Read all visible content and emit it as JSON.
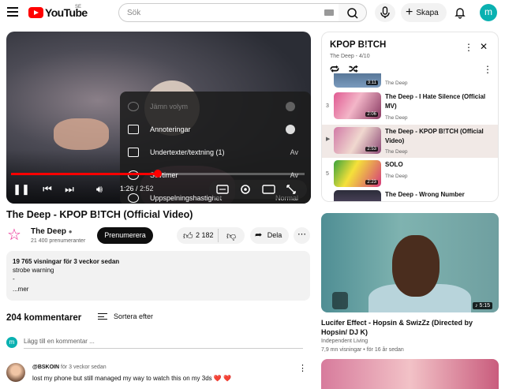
{
  "header": {
    "logo_text": "YouTube",
    "country_code": "SE",
    "search_placeholder": "Sök",
    "create_label": "Skapa",
    "avatar_letter": "m"
  },
  "player": {
    "settings_menu": [
      {
        "label": "Jämn volym",
        "value": "",
        "type": "toggle",
        "disabled": true
      },
      {
        "label": "Annoteringar",
        "value": "",
        "type": "toggle",
        "disabled": false
      },
      {
        "label": "Undertexter/textning (1)",
        "value": "Av",
        "type": "submenu",
        "disabled": false
      },
      {
        "label": "Sovtimer",
        "value": "Av",
        "type": "submenu",
        "disabled": false
      },
      {
        "label": "Uppspelningshastighet",
        "value": "Normal",
        "type": "submenu",
        "disabled": false
      }
    ],
    "current_time": "1:26",
    "duration": "2:52",
    "progress_fraction": 0.5
  },
  "video": {
    "title": "The Deep - KPOP B!TCH (Official Video)",
    "channel": "The Deep",
    "subscribers": "21 400 prenumeranter",
    "subscribe_label": "Prenumerera",
    "likes": "2 182",
    "share_label": "Dela",
    "views_line": "19 765 visningar  för 3 veckor sedan",
    "description_line1": "strobe warning",
    "description_line2": "-",
    "more_label": "...mer"
  },
  "comments": {
    "count_label": "204 kommentarer",
    "sort_label": "Sortera efter",
    "add_placeholder": "Lägg till en kommentar ...",
    "avatar_letter": "m",
    "items": [
      {
        "author": "@BSKOIN",
        "time": "för 3 veckor sedan",
        "text": "lost my phone but still managed my way to watch this on my 3ds ❤️ ❤️"
      }
    ]
  },
  "playlist": {
    "title": "KPOP B!TCH",
    "subtitle": "The Deep - 4/10",
    "items": [
      {
        "num": "",
        "title": "",
        "channel": "The Deep",
        "duration": "3:11",
        "active": false
      },
      {
        "num": "3",
        "title": "The Deep - I Hate Silence (Official MV)",
        "channel": "The Deep",
        "duration": "2:06",
        "active": false
      },
      {
        "num": "▶",
        "title": "The Deep - KPOP B!TCH (Official Video)",
        "channel": "The Deep",
        "duration": "2:53",
        "active": true
      },
      {
        "num": "5",
        "title": "SOLO",
        "channel": "The Deep",
        "duration": "2:23",
        "active": false
      },
      {
        "num": "6",
        "title": "The Deep - Wrong Number",
        "channel": "",
        "duration": "",
        "active": false
      }
    ]
  },
  "recommended": {
    "title": "Lucifer Effect - Hopsin & SwizZz  (Directed by Hopsin/ DJ K)",
    "channel": "Independent Living",
    "meta": "7,9 mn visningar  •  för 16 år sedan",
    "duration": "5:15"
  }
}
